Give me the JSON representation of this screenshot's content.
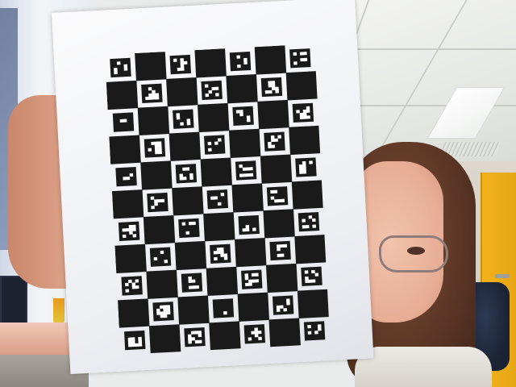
{
  "scene": {
    "description_colors": {
      "paper": "#f6f7f9",
      "board_black": "#1a1a1a",
      "marker_white": "#ffffff",
      "door": "#f2b21c",
      "hair": "#5a3525",
      "skin": "#e7ad95",
      "chair": "#2d3a54"
    },
    "board": {
      "type": "charuco-board",
      "columns": 7,
      "rows": 11,
      "first_square": "white"
    }
  }
}
